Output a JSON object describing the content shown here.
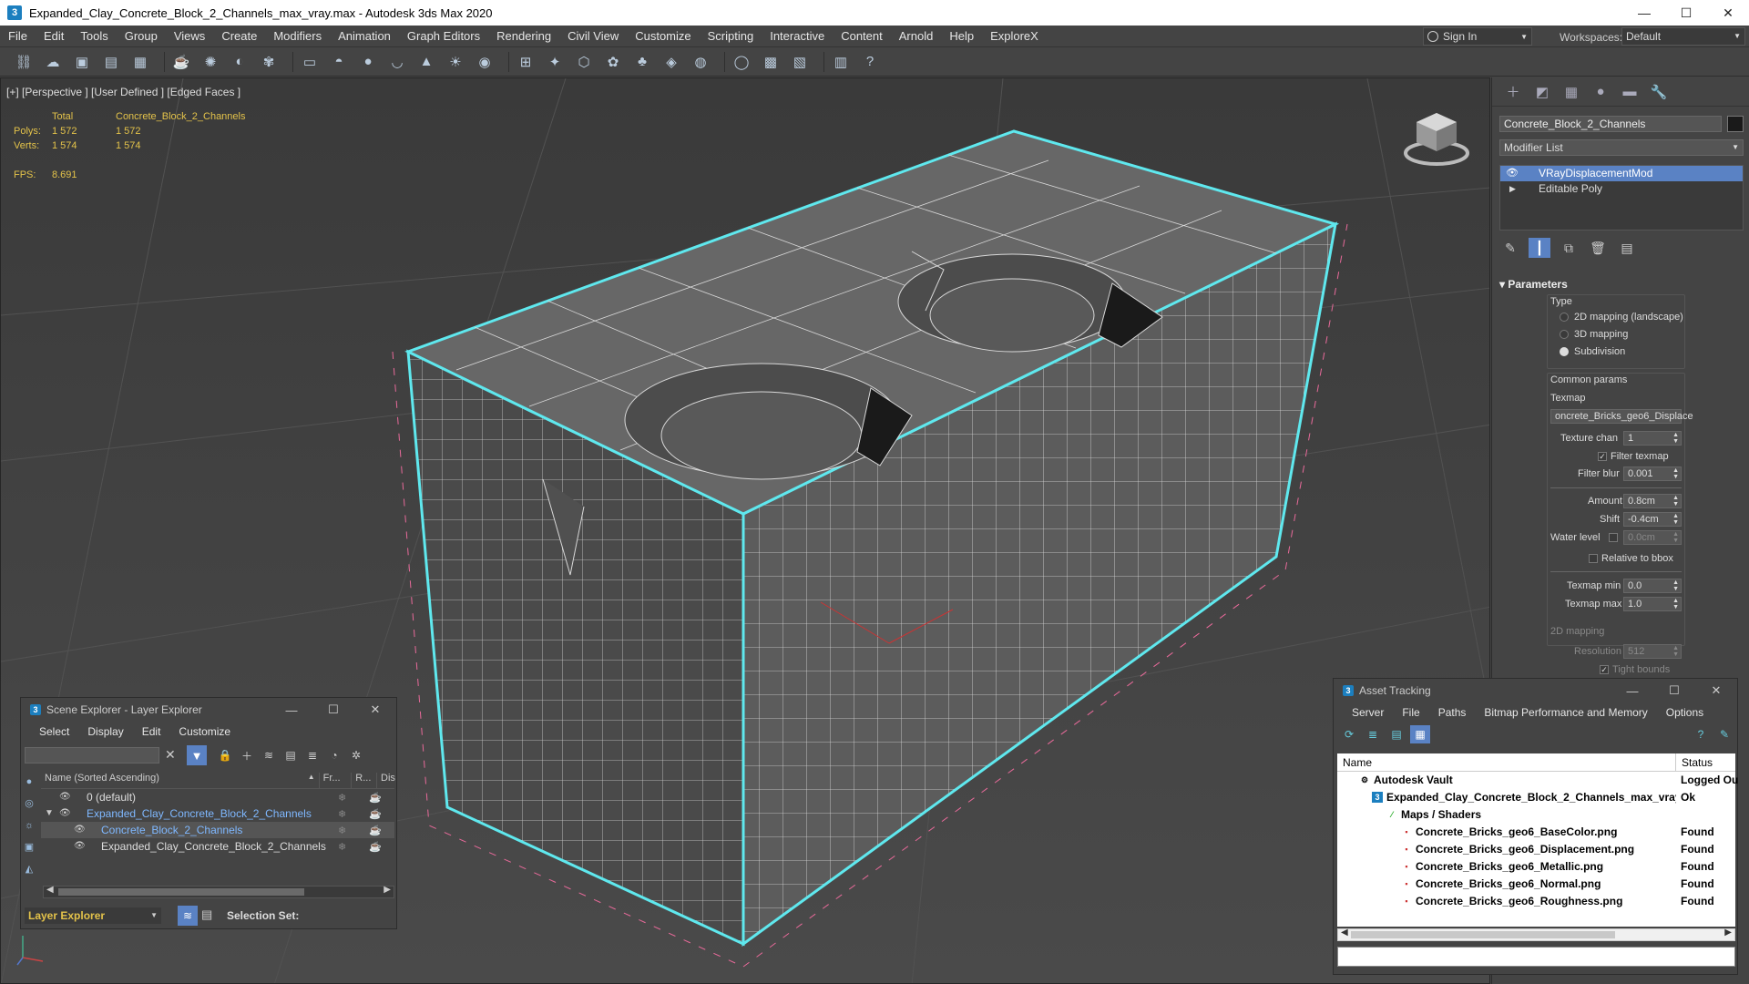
{
  "titlebar": {
    "title": "Expanded_Clay_Concrete_Block_2_Channels_max_vray.max - Autodesk 3ds Max 2020",
    "app_icon": "3",
    "minimize": "—",
    "maximize": "☐",
    "close": "✕"
  },
  "menu": [
    "File",
    "Edit",
    "Tools",
    "Group",
    "Views",
    "Create",
    "Modifiers",
    "Animation",
    "Graph Editors",
    "Rendering",
    "Civil View",
    "Customize",
    "Scripting",
    "Interactive",
    "Content",
    "Arnold",
    "Help",
    "ExploreX"
  ],
  "signin": {
    "label": "Sign In"
  },
  "workspaces": {
    "label": "Workspaces:",
    "value": "Default"
  },
  "viewport": {
    "label": "[+] [Perspective ] [User Defined ] [Edged Faces ]",
    "stats": {
      "col_total": "Total",
      "col_object": "Concrete_Block_2_Channels",
      "polys_label": "Polys:",
      "polys_total": "1 572",
      "polys_object": "1 572",
      "verts_label": "Verts:",
      "verts_total": "1 574",
      "verts_object": "1 574",
      "fps_label": "FPS:",
      "fps_value": "8.691"
    }
  },
  "command_panel": {
    "object_name": "Concrete_Block_2_Channels",
    "modifier_list": "Modifier List",
    "stack": [
      {
        "label": "VRayDisplacementMod",
        "selected": true
      },
      {
        "label": "Editable Poly",
        "selected": false
      }
    ],
    "parameters": {
      "header": "Parameters",
      "type_label": "Type",
      "type_options": [
        "2D mapping (landscape)",
        "3D mapping",
        "Subdivision"
      ],
      "type_selected": "Subdivision",
      "common_params": "Common params",
      "texmap_label": "Texmap",
      "texmap_value": "oncrete_Bricks_geo6_Displace",
      "texture_chan_label": "Texture chan",
      "texture_chan_value": "1",
      "filter_texmap_label": "Filter texmap",
      "filter_blur_label": "Filter blur",
      "filter_blur_value": "0.001",
      "amount_label": "Amount",
      "amount_value": "0.8cm",
      "shift_label": "Shift",
      "shift_value": "-0.4cm",
      "water_level_label": "Water level",
      "water_level_value": "0.0cm",
      "relative_bbox_label": "Relative to bbox",
      "texmap_min_label": "Texmap min",
      "texmap_min_value": "0.0",
      "texmap_max_label": "Texmap max",
      "texmap_max_value": "1.0",
      "mapping_2d_label": "2D mapping",
      "resolution_label": "Resolution",
      "resolution_value": "512",
      "tight_bounds_label": "Tight bounds"
    }
  },
  "scene_explorer": {
    "title": "Scene Explorer - Layer Explorer",
    "menu": [
      "Select",
      "Display",
      "Edit",
      "Customize"
    ],
    "columns": {
      "name": "Name (Sorted Ascending)",
      "frozen": "Fr...",
      "render": "R...",
      "display": "Dis"
    },
    "rows": [
      {
        "name": "0 (default)"
      },
      {
        "name": "Expanded_Clay_Concrete_Block_2_Channels"
      },
      {
        "name": "Concrete_Block_2_Channels"
      },
      {
        "name": "Expanded_Clay_Concrete_Block_2_Channels"
      }
    ],
    "layer_dropdown": "Layer Explorer",
    "selection_set": "Selection Set:"
  },
  "asset_tracking": {
    "title": "Asset Tracking",
    "menu": [
      "Server",
      "File",
      "Paths",
      "Bitmap Performance and Memory",
      "Options"
    ],
    "columns": {
      "name": "Name",
      "status": "Status"
    },
    "rows": [
      {
        "name": "Autodesk Vault",
        "status": "Logged Ou"
      },
      {
        "name": "Expanded_Clay_Concrete_Block_2_Channels_max_vray.max",
        "status": "Ok"
      },
      {
        "name": "Maps / Shaders",
        "status": ""
      },
      {
        "name": "Concrete_Bricks_geo6_BaseColor.png",
        "status": "Found"
      },
      {
        "name": "Concrete_Bricks_geo6_Displacement.png",
        "status": "Found"
      },
      {
        "name": "Concrete_Bricks_geo6_Metallic.png",
        "status": "Found"
      },
      {
        "name": "Concrete_Bricks_geo6_Normal.png",
        "status": "Found"
      },
      {
        "name": "Concrete_Bricks_geo6_Roughness.png",
        "status": "Found"
      }
    ]
  },
  "colors": {
    "accent": "#5a82c4",
    "selection_outline": "#5fe8ee",
    "stats_text": "#e3c24a"
  }
}
